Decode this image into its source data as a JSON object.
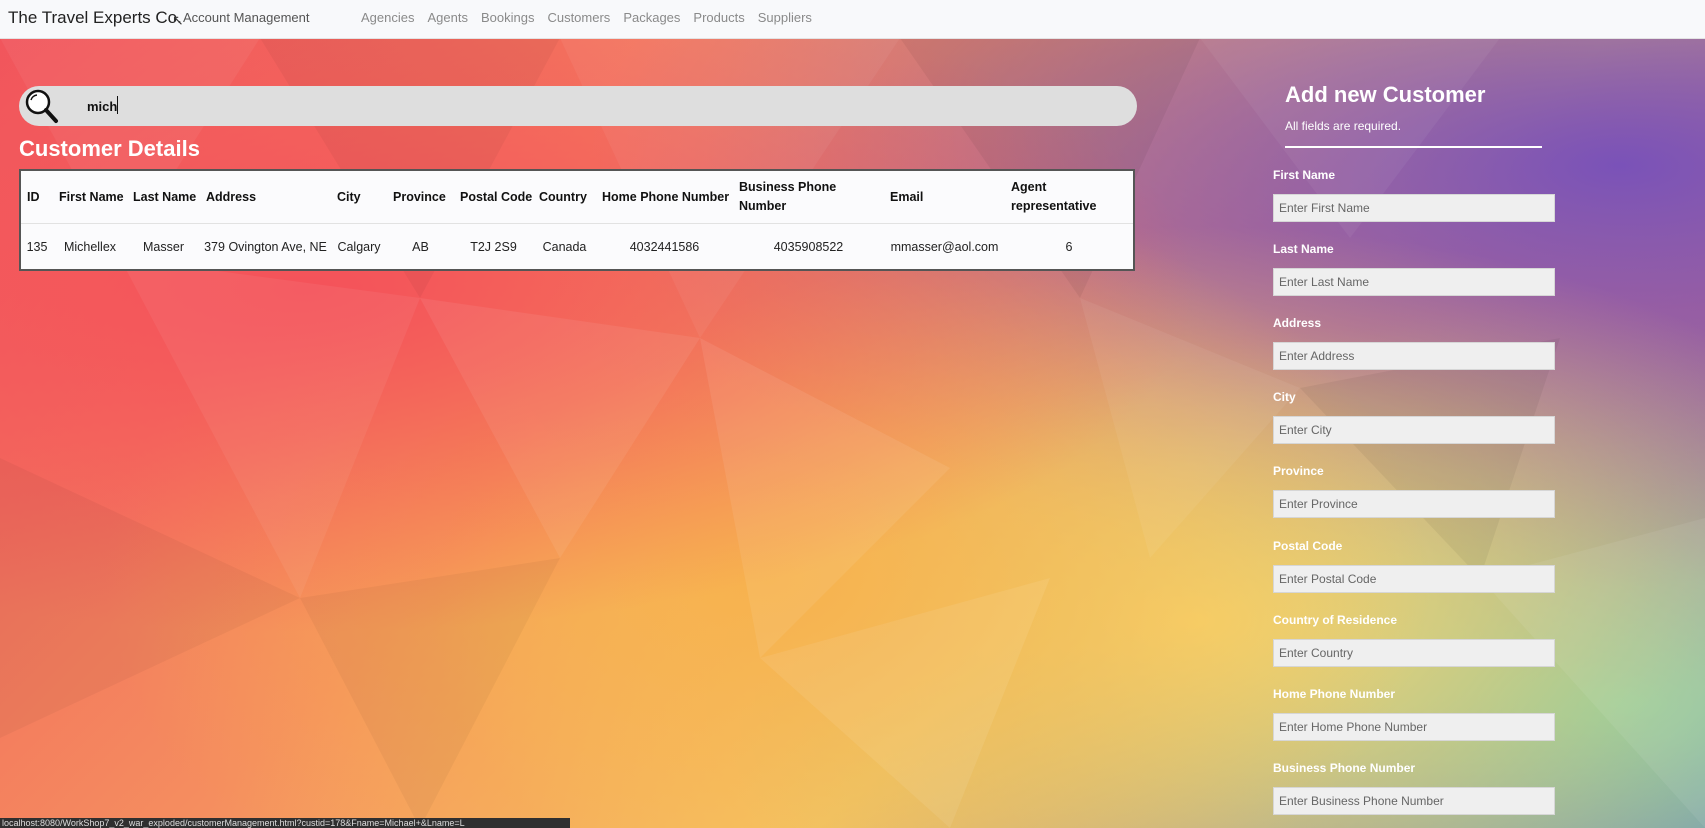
{
  "navbar": {
    "brand": "The Travel Experts Co.",
    "account": "Account Management",
    "links": [
      "Agencies",
      "Agents",
      "Bookings",
      "Customers",
      "Packages",
      "Products",
      "Suppliers"
    ]
  },
  "search": {
    "value": "mich",
    "icon": "search-icon"
  },
  "table": {
    "title": "Customer Details",
    "headers": [
      "ID",
      "First Name",
      "Last Name",
      "Address",
      "City",
      "Province",
      "Postal Code",
      "Country",
      "Home Phone Number",
      "Business Phone Number",
      "Email",
      "Agent representative"
    ],
    "rows": [
      [
        "135",
        "Michellex",
        "Masser",
        "379 Ovington Ave, NE",
        "Calgary",
        "AB",
        "T2J 2S9",
        "Canada",
        "4032441586",
        "4035908522",
        "mmasser@aol.com",
        "6"
      ]
    ]
  },
  "form": {
    "title": "Add new Customer",
    "subtitle": "All fields are required.",
    "fields": [
      {
        "label": "First Name",
        "placeholder": "Enter First Name"
      },
      {
        "label": "Last Name",
        "placeholder": "Enter Last Name"
      },
      {
        "label": "Address",
        "placeholder": "Enter Address"
      },
      {
        "label": "City",
        "placeholder": "Enter City"
      },
      {
        "label": "Province",
        "placeholder": "Enter Province"
      },
      {
        "label": "Postal Code",
        "placeholder": "Enter Postal Code"
      },
      {
        "label": "Country of Residence",
        "placeholder": "Enter Country"
      },
      {
        "label": "Home Phone Number",
        "placeholder": "Enter Home Phone Number"
      },
      {
        "label": "Business Phone Number",
        "placeholder": "Enter Business Phone Number"
      }
    ]
  },
  "statusbar": {
    "url": "localhost:8080/WorkShop7_v2_war_exploded/customerManagement.html?custid=178&Fname=Michael+&Lname=L"
  },
  "colors": {
    "navbar_bg": "#f8f9fb",
    "search_bg": "#dedede",
    "nav_link": "#8a8a8a"
  }
}
